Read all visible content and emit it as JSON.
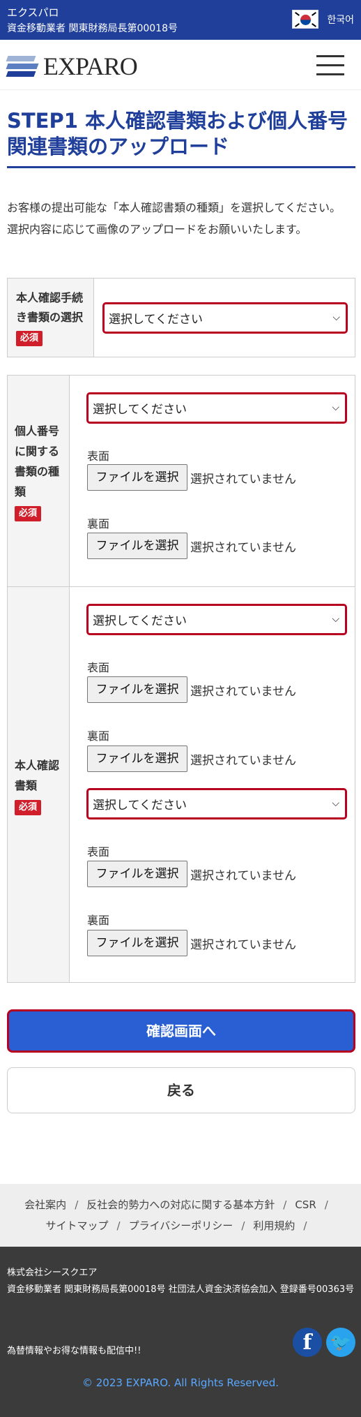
{
  "topbar": {
    "brand_kana": "エクスパロ",
    "registration": "資金移動業者 関東財務局長第00018号",
    "language_label": "한국어"
  },
  "header": {
    "logo_text": "EXPARO",
    "menu_icon": "hamburger-menu-icon"
  },
  "page": {
    "title": "STEP1 本人確認書類および個人番号関連書類のアップロード",
    "intro_line1": "お客様の提出可能な「本人確認書類の種類」を選択してください。",
    "intro_line2": "選択内容に応じて画像のアップロードをお願いいたします。"
  },
  "form": {
    "procedure": {
      "label": "本人確認手続き書類の選択",
      "required": "必須",
      "select_value": "選択してください"
    },
    "mynumber": {
      "label": "個人番号に関する書類の種類",
      "required": "必須",
      "select_value": "選択してください",
      "front_label": "表面",
      "back_label": "裏面",
      "file_button": "ファイルを選択",
      "no_file": "選択されていません"
    },
    "identity": {
      "label": "本人確認書類",
      "required": "必須",
      "select1_value": "選択してください",
      "select2_value": "選択してください",
      "front_label": "表面",
      "back_label": "裏面",
      "file_button": "ファイルを選択",
      "no_file": "選択されていません"
    }
  },
  "buttons": {
    "confirm": "確認画面へ",
    "back": "戻る"
  },
  "footer": {
    "nav": [
      "会社案内",
      "反社会的勢力への対応に関する基本方針",
      "CSR",
      "サイトマップ",
      "プライバシーポリシー",
      "利用規約"
    ],
    "separator": "/",
    "company": "株式会社シースクエア",
    "registration": "資金移動業者 関東財務局長第00018号 社団法人資金決済協会加入 登録番号00363号",
    "news": "為替情報やお得な情報も配信中!!",
    "facebook_glyph": "f",
    "twitter_glyph": "🐦",
    "copyright": "© 2023 EXPARO. All Rights Reserved."
  },
  "colors": {
    "brand_blue": "#1f3f9b",
    "button_blue": "#2a5fd3",
    "required_red": "#d01f2a",
    "focus_red": "#b8001f"
  }
}
